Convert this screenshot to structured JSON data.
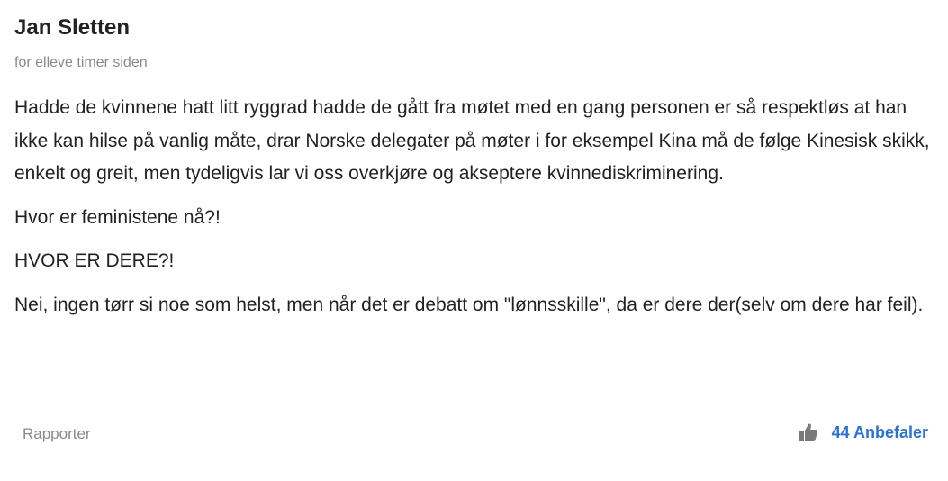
{
  "comment": {
    "author": "Jan Sletten",
    "timestamp": "for elleve timer siden",
    "paragraphs": [
      "Hadde de kvinnene hatt litt ryggrad hadde de gått fra møtet med en gang personen er så respektløs at han ikke kan hilse på vanlig måte, drar Norske delegater på møter i for eksempel Kina må de følge Kinesisk skikk, enkelt og greit, men tydeligvis lar vi oss overkjøre og akseptere kvinnediskriminering.",
      "Hvor er feministene nå?!",
      "HVOR ER DERE?!",
      "Nei, ingen tørr si noe som helst, men når det er debatt om \"lønnsskille\", da er dere der(selv om dere har feil)."
    ]
  },
  "footer": {
    "report_label": "Rapporter",
    "recommend_label": "44 Anbefaler",
    "recommend_icon": "thumbs-up-icon"
  },
  "colors": {
    "text": "#222222",
    "muted": "#8a8a8a",
    "accent": "#2d72d2",
    "icon": "#7a7a7a"
  }
}
